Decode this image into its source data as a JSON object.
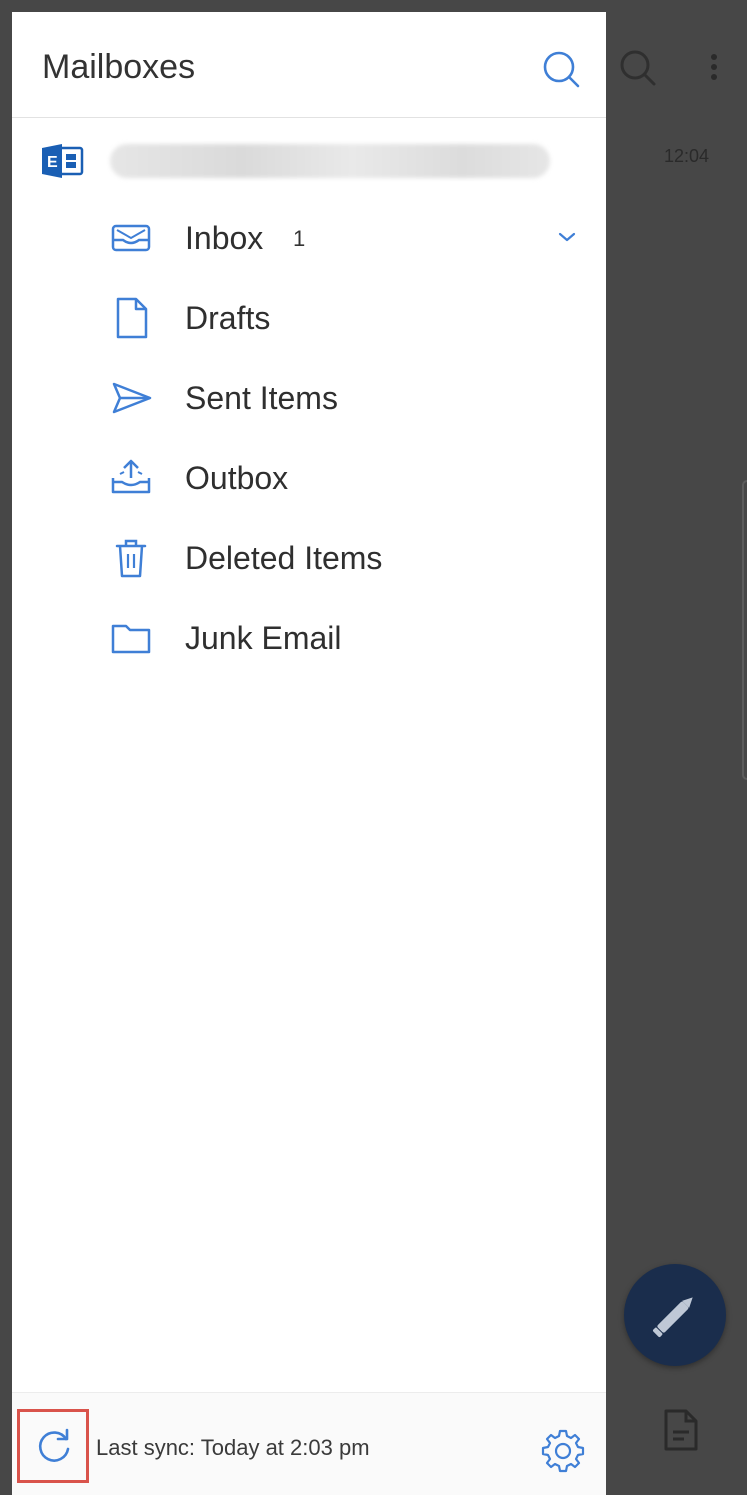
{
  "drawer": {
    "title": "Mailboxes",
    "account": {
      "name": "",
      "icon": "exchange-icon"
    },
    "folders": [
      {
        "label": "Inbox",
        "count": "1",
        "icon": "inbox-icon",
        "expandable": true
      },
      {
        "label": "Drafts",
        "icon": "draft-document-icon"
      },
      {
        "label": "Sent Items",
        "icon": "send-icon"
      },
      {
        "label": "Outbox",
        "icon": "outbox-icon"
      },
      {
        "label": "Deleted Items",
        "icon": "trash-icon"
      },
      {
        "label": "Junk Email",
        "icon": "folder-icon"
      }
    ],
    "footer": {
      "sync_text": "Last sync: Today at 2:03 pm",
      "refresh_icon": "refresh-icon",
      "settings_icon": "gear-icon"
    }
  },
  "background": {
    "message_time": "12:04",
    "fab_icon": "pencil-icon"
  },
  "colors": {
    "accent": "#3f7fd6",
    "scrim": "#474747",
    "fab": "#1a2d4c",
    "highlight": "#d9534b"
  }
}
